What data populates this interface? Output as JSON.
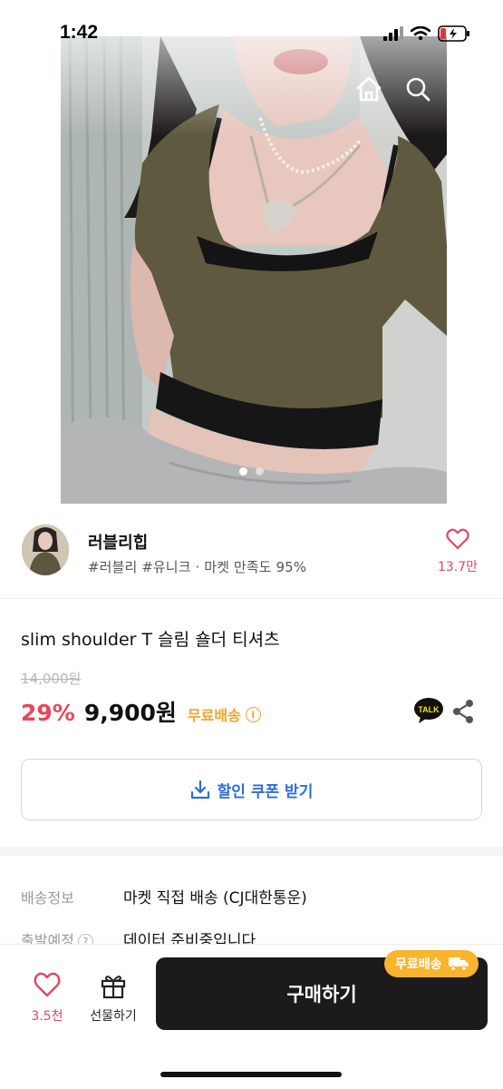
{
  "status_bar": {
    "time": "1:42"
  },
  "nav": {
    "back": "back-arrow",
    "icons": [
      "home-icon",
      "search-icon",
      "cart-icon"
    ]
  },
  "hero": {
    "page_count": 2,
    "active_page": 1
  },
  "shop": {
    "name": "러블리힙",
    "meta": "#러블리 #유니크 · 마켓 만족도 95%",
    "like_count": "13.7만"
  },
  "product": {
    "title": "slim shoulder T 슬림 숄더 티셔츠",
    "original_price": "14,000원",
    "discount": "29%",
    "price": "9,900원",
    "free_shipping": "무료배송",
    "talk_badge": "TALK"
  },
  "coupon": {
    "label": "할인 쿠폰 받기"
  },
  "delivery": {
    "rows": [
      {
        "label": "배송정보",
        "value": "마켓 직접 배송 (CJ대한통운)"
      },
      {
        "label": "출발예정",
        "value": "데이터 준비중입니다"
      }
    ]
  },
  "bottom_bar": {
    "like_count": "3.5천",
    "gift_label": "선물하기",
    "buy_label": "구매하기",
    "free_badge": "무료배송"
  },
  "colors": {
    "accent_red": "#e8475b",
    "free_ship_orange": "#f2a32a",
    "coupon_blue": "#2d6fd6",
    "buy_button": "#1b1b1b"
  }
}
